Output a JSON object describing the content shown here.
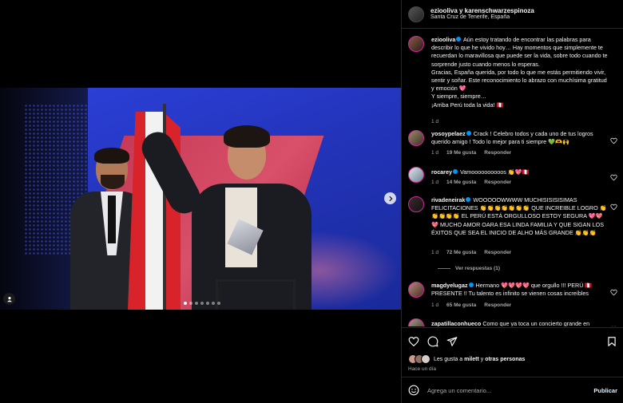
{
  "post": {
    "header": {
      "title": "eziooliva y karenschwarzespinoza",
      "location": "Santa Cruz de Tenerife, España"
    },
    "caption": {
      "user": "eziooliva",
      "text": "Aún estoy tratando de encontrar las palabras para describir lo que he vivido hoy… Hay momentos que simplemente te recuerdan lo maravillosa que puede ser la vida, sobre todo cuando te sorprende justo cuando menos lo esperas.\nGracias, España querida, por todo lo que me estás permitiendo vivir, sentir y soñar. Este reconocimiento lo abrazo con muchísima gratitud y emoción 💖\nY siempre, siempre…\n¡Arriba Perú toda la vida! 🇵🇪",
      "time": "1 d"
    },
    "comments": [
      {
        "user": "yosoypelaez",
        "text": "Crack ! Celebro todos y cada uno de tus logros querido amigo ! Todo lo mejor para ti siempre 💚🫶🙌",
        "time": "1 d",
        "likes": "19 Me gusta",
        "reply": "Responder"
      },
      {
        "user": "rocarey",
        "text": "Vamoooooooooos 👏💖🇵🇪",
        "time": "1 d",
        "likes": "14 Me gusta",
        "reply": "Responder"
      },
      {
        "user": "rivadeneirak",
        "text": "WOOOOOWWWW MUCHISISISISIMAS FELICITACIONES 👏👏👏👏👏👏👏 QUE INCREIBLE LOGRO 👏👏👏👏👏 EL PERÚ ESTÁ ORGULLOSO ESTOY SEGURA 💖💖💖 MUCHO AMOR OARA ESA LINDA FAMILIA Y QUE SIGAN LOS ÉXITOS QUE SEA EL INICIO DE ALHO MÁS GRANDE 👏👏👏",
        "time": "1 d",
        "likes": "72 Me gusta",
        "reply": "Responder",
        "replies": "Ver respuestas (1)"
      },
      {
        "user": "magdyelugaz",
        "text": "Hermano 💖💖💖💖 que orgullo !!! PERÚ 🇵🇪 PRESENTE !! Tu talento es infinito se vienen cosas increíbles",
        "time": "1 d",
        "likes": "65 Me gusta",
        "reply": "Responder"
      },
      {
        "user": "zapatillaconhueco",
        "text": "Como que ya toca un concierto grande en"
      }
    ],
    "likes_text_prefix": "Les gusta a ",
    "likes_user": "milett",
    "likes_mid": " y ",
    "likes_others": "otras personas",
    "timestamp": "Hace un día",
    "comment_placeholder": "Agrega un comentario...",
    "publish_label": "Publicar"
  },
  "colors": {
    "accent_blue": "#0095f6",
    "heart_red": "#ff3040",
    "muted_text": "#a8a8a8"
  },
  "icons": [
    "heart-icon",
    "comment-icon",
    "share-icon",
    "save-icon",
    "emoji-icon",
    "chevron-right-icon",
    "tag-user-icon"
  ]
}
